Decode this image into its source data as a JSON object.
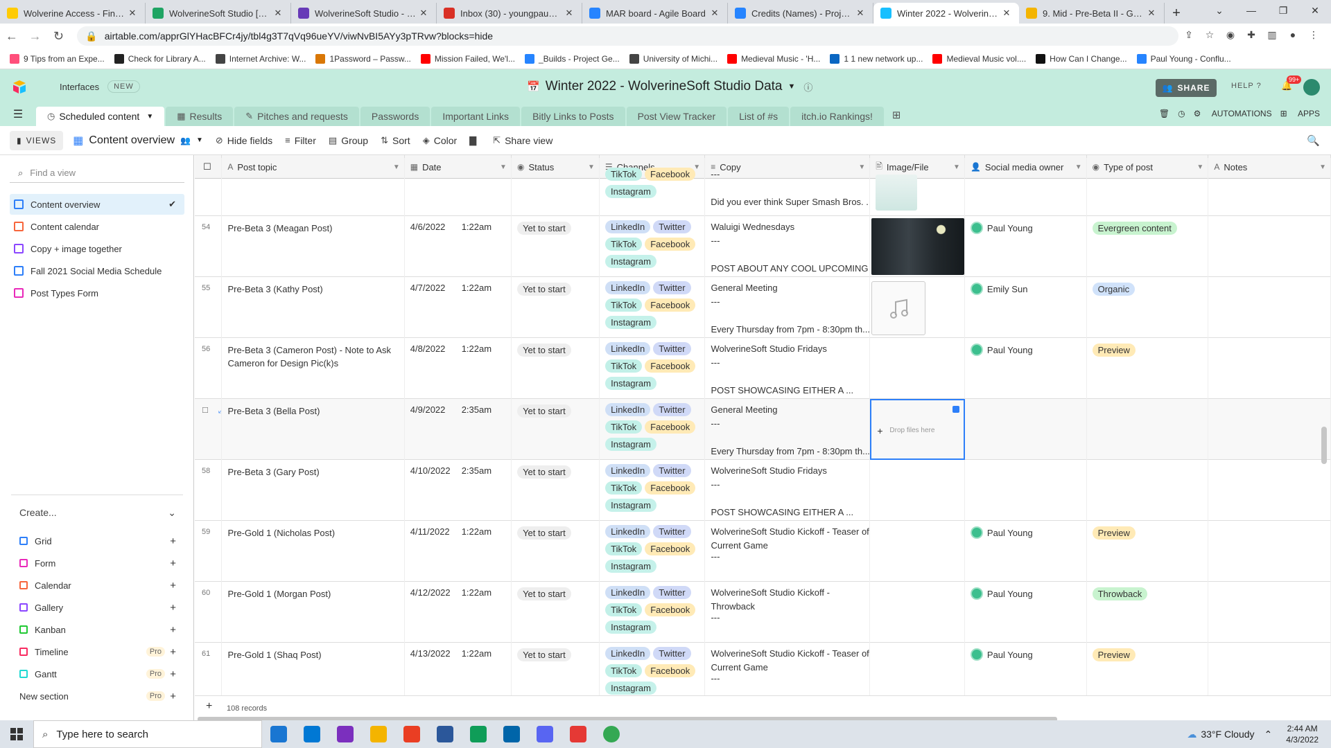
{
  "browser": {
    "tabs": [
      {
        "title": "Wolverine Access - Find &",
        "color": "#ffcb05",
        "active": false
      },
      {
        "title": "WolverineSoft Studio [Mar",
        "color": "#1fa463",
        "active": false
      },
      {
        "title": "WolverineSoft Studio - Wo",
        "color": "#673ab7",
        "active": false
      },
      {
        "title": "Inbox (30) - youngpau@ur",
        "color": "#d93025",
        "active": false
      },
      {
        "title": "MAR board - Agile Board",
        "color": "#2684ff",
        "active": false
      },
      {
        "title": "Credits (Names) - Project I",
        "color": "#2684ff",
        "active": false
      },
      {
        "title": "Winter 2022 - WolverineSo",
        "color": "#18bfff",
        "active": true
      },
      {
        "title": "9. Mid - Pre-Beta II - Goog",
        "color": "#f4b400",
        "active": false
      }
    ],
    "new_tab": "+",
    "window_controls": [
      "⌄",
      "—",
      "❐",
      "✕"
    ],
    "url": "airtable.com/apprGlYHacBFCr4jy/tbl4g3T7qVq96ueYV/viwNvBI5AYy3pTRvw?blocks=hide",
    "bookmarks": [
      {
        "label": "9 Tips from an Expe...",
        "color": "#ff4f7b"
      },
      {
        "label": "Check for Library A...",
        "color": "#222"
      },
      {
        "label": "Internet Archive: W...",
        "color": "#444"
      },
      {
        "label": "1Password – Passw...",
        "color": "#d97706"
      },
      {
        "label": "Mission Failed, We'l...",
        "color": "#ff0000"
      },
      {
        "label": "_Builds - Project Ge...",
        "color": "#2684ff"
      },
      {
        "label": "University of Michi...",
        "color": "#444"
      },
      {
        "label": "Medieval Music - 'H...",
        "color": "#ff0000"
      },
      {
        "label": "1 1 new network up...",
        "color": "#0a66c2"
      },
      {
        "label": "Medieval Music vol....",
        "color": "#ff0000"
      },
      {
        "label": "How Can I Change...",
        "color": "#111"
      },
      {
        "label": "Paul Young - Conflu...",
        "color": "#2684ff"
      }
    ]
  },
  "app": {
    "interfaces": "Interfaces",
    "new_badge": "NEW",
    "base_title": "Winter 2022 - WolverineSoft Studio Data",
    "share": "SHARE",
    "help": "HELP",
    "notif_count": "99+",
    "tables": [
      {
        "label": "Scheduled content",
        "active": true
      },
      {
        "label": "Results",
        "active": false
      },
      {
        "label": "Pitches and requests",
        "active": false
      },
      {
        "label": "Passwords",
        "active": false
      },
      {
        "label": "Important Links",
        "active": false
      },
      {
        "label": "Bitly Links to Posts",
        "active": false
      },
      {
        "label": "Post View Tracker",
        "active": false
      },
      {
        "label": "List of #s",
        "active": false
      },
      {
        "label": "itch.io Rankings!",
        "active": false
      }
    ],
    "automations": "AUTOMATIONS",
    "apps": "APPS"
  },
  "viewbar": {
    "views": "VIEWS",
    "current_view": "Content overview",
    "hide_fields": "Hide fields",
    "filter": "Filter",
    "group": "Group",
    "sort": "Sort",
    "color": "Color",
    "share_view": "Share view"
  },
  "sidebar": {
    "find_placeholder": "Find a view",
    "views": [
      {
        "label": "Content overview",
        "color": "#2d7ff9",
        "selected": true
      },
      {
        "label": "Content calendar",
        "color": "#f7653b",
        "selected": false
      },
      {
        "label": "Copy + image together",
        "color": "#8b46ff",
        "selected": false
      },
      {
        "label": "Fall 2021 Social Media Schedule",
        "color": "#2d7ff9",
        "selected": false
      },
      {
        "label": "Post Types Form",
        "color": "#e929ba",
        "selected": false
      }
    ],
    "create_label": "Create...",
    "create_items": [
      {
        "label": "Grid",
        "color": "#2d7ff9",
        "pro": ""
      },
      {
        "label": "Form",
        "color": "#e929ba",
        "pro": ""
      },
      {
        "label": "Calendar",
        "color": "#f7653b",
        "pro": ""
      },
      {
        "label": "Gallery",
        "color": "#8b46ff",
        "pro": ""
      },
      {
        "label": "Kanban",
        "color": "#20c933",
        "pro": ""
      },
      {
        "label": "Timeline",
        "color": "#f82b60",
        "pro": "Pro"
      },
      {
        "label": "Gantt",
        "color": "#20d9d2",
        "pro": "Pro"
      },
      {
        "label": "New section",
        "color": "",
        "pro": "Pro"
      }
    ]
  },
  "grid": {
    "columns": [
      "Post topic",
      "Date",
      "Status",
      "Channels",
      "Copy",
      "Image/File",
      "Social media owner",
      "Type of post",
      "Notes"
    ],
    "partial_row": {
      "channels": [
        "TikTok",
        "Facebook",
        "Instagram"
      ],
      "copy_line3": "Did you ever think Super Smash Bros. ..."
    },
    "rows": [
      {
        "num": "54",
        "topic": "Pre-Beta 3 (Meagan Post)",
        "date": "4/6/2022",
        "time": "1:22am",
        "status": "Yet to start",
        "copy1": "Waluigi Wednesdays",
        "copy2": "---",
        "copy3": "POST ABOUT ANY COOL UPCOMING ...",
        "image": "photo",
        "owner": "Paul Young",
        "type": "Evergreen content",
        "type_class": "tp-ev"
      },
      {
        "num": "55",
        "topic": "Pre-Beta 3 (Kathy Post)",
        "date": "4/7/2022",
        "time": "1:22am",
        "status": "Yet to start",
        "copy1": "General Meeting",
        "copy2": "---",
        "copy3": "Every Thursday from 7pm - 8:30pm th...",
        "image": "music",
        "owner": "Emily Sun",
        "type": "Organic",
        "type_class": "tp-org"
      },
      {
        "num": "56",
        "topic": "Pre-Beta 3 (Cameron Post) - Note to Ask Cameron for Design Pic(k)s",
        "date": "4/8/2022",
        "time": "1:22am",
        "status": "Yet to start",
        "copy1": "WolverineSoft Studio Fridays",
        "copy2": "---",
        "copy3": "POST SHOWCASING EITHER A ...",
        "image": "",
        "owner": "Paul Young",
        "type": "Preview",
        "type_class": "tp-pre"
      },
      {
        "num": "",
        "topic": "Pre-Beta 3 (Bella Post)",
        "date": "4/9/2022",
        "time": "2:35am",
        "status": "Yet to start",
        "copy1": "General Meeting",
        "copy2": "---",
        "copy3": "Every Thursday from 7pm - 8:30pm th...",
        "image": "drop",
        "owner": "",
        "type": "",
        "type_class": ""
      },
      {
        "num": "58",
        "topic": "Pre-Beta 3 (Gary Post)",
        "date": "4/10/2022",
        "time": "2:35am",
        "status": "Yet to start",
        "copy1": "WolverineSoft Studio Fridays",
        "copy2": "---",
        "copy3": "POST SHOWCASING EITHER A ...",
        "image": "",
        "owner": "",
        "type": "",
        "type_class": ""
      },
      {
        "num": "59",
        "topic": "Pre-Gold 1 (Nicholas Post)",
        "date": "4/11/2022",
        "time": "1:22am",
        "status": "Yet to start",
        "copy1": "WolverineSoft Studio Kickoff - Teaser of",
        "copy2": "Current Game",
        "copy3": "---",
        "image": "",
        "owner": "Paul Young",
        "type": "Preview",
        "type_class": "tp-pre"
      },
      {
        "num": "60",
        "topic": "Pre-Gold 1 (Morgan Post)",
        "date": "4/12/2022",
        "time": "1:22am",
        "status": "Yet to start",
        "copy1": "WolverineSoft Studio Kickoff -",
        "copy2": "Throwback",
        "copy3": "---",
        "image": "",
        "owner": "Paul Young",
        "type": "Throwback",
        "type_class": "tp-thr"
      },
      {
        "num": "61",
        "topic": "Pre-Gold 1 (Shaq Post)",
        "date": "4/13/2022",
        "time": "1:22am",
        "status": "Yet to start",
        "copy1": "WolverineSoft Studio Kickoff - Teaser of",
        "copy2": "Current Game",
        "copy3": "---",
        "image": "",
        "owner": "Paul Young",
        "type": "Preview",
        "type_class": "tp-pre"
      }
    ],
    "channels": [
      "LinkedIn",
      "Twitter",
      "TikTok",
      "Facebook",
      "Instagram"
    ],
    "drop_text": "Drop files here",
    "record_count": "108 records"
  },
  "taskbar": {
    "search_placeholder": "Type here to search",
    "weather": "33°F  Cloudy",
    "time": "2:44 AM",
    "date": "4/3/2022",
    "apps": [
      "#1976d2",
      "#0078d4",
      "#7b2fbe",
      "#f4b400",
      "#ea3e23",
      "#2b579a",
      "#0f9d58",
      "#0065a9",
      "#5865f2",
      "#e53935",
      "#34a853"
    ]
  }
}
